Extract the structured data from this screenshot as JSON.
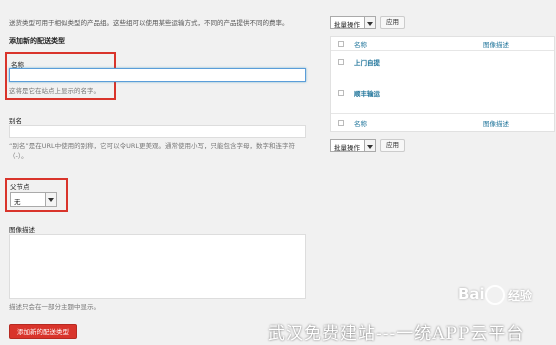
{
  "intro_text": "送货类型可用于相似类型的产品组。这些组可以使用某些运输方式，不同的产品提供不同的费率。",
  "form": {
    "section_title": "添加新的配送类型",
    "name_label": "名称",
    "name_value": "",
    "name_help": "这将是它在站点上显示的名字。",
    "slug_label": "别名",
    "slug_value": "",
    "slug_help": "“别名”是在URL中使用的别称，它可以令URL更美观。通常使用小写，只能包含字母，数字和连字符（-）。",
    "parent_label": "父节点",
    "parent_value": "无",
    "desc_label": "图像描述",
    "desc_value": "",
    "desc_help": "描述只会在一部分主题中显示。",
    "submit_label": "添加新的配送类型"
  },
  "bulk_top": {
    "select_value": "批量操作",
    "apply_label": "应用"
  },
  "bulk_bottom": {
    "select_value": "批量操作",
    "apply_label": "应用"
  },
  "table": {
    "col_name": "名称",
    "col_desc": "图像描述",
    "rows": [
      {
        "name": "上门自提",
        "desc": ""
      },
      {
        "name": "顺丰输运",
        "desc": ""
      }
    ],
    "foot_name": "名称",
    "foot_desc": "图像描述"
  },
  "watermark": {
    "brand": "Bai",
    "brand2": "经验",
    "caption": "武汉免费建站---一统APP云平台"
  }
}
